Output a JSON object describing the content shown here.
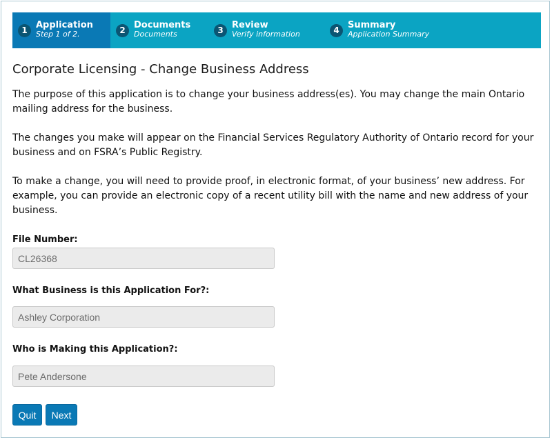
{
  "wizard": {
    "steps": [
      {
        "number": "1",
        "title": "Application",
        "subtitle": "Step 1 of 2."
      },
      {
        "number": "2",
        "title": "Documents",
        "subtitle": "Documents"
      },
      {
        "number": "3",
        "title": "Review",
        "subtitle": "Verify information"
      },
      {
        "number": "4",
        "title": "Summary",
        "subtitle": "Application Summary"
      }
    ],
    "active_step": 1
  },
  "page": {
    "title": "Corporate Licensing - Change Business Address",
    "paragraphs": [
      "The purpose of this application is to change your business address(es). You may change the main Ontario mailing address for the business.",
      "The changes you make will appear on the Financial Services Regulatory Authority of Ontario record for your business and on FSRA’s Public Registry.",
      "To make a change, you will need to provide proof, in electronic format, of your business’ new address. For example, you can provide an electronic copy of a recent utility bill with the name and new address of your business."
    ]
  },
  "form": {
    "file_number": {
      "label": "File Number:",
      "value": "CL26368"
    },
    "business": {
      "label": "What Business is this Application For?:",
      "value": "Ashley Corporation"
    },
    "applicant": {
      "label": "Who is Making this Application?:",
      "value": "Pete Andersone"
    }
  },
  "buttons": {
    "quit": "Quit",
    "next": "Next"
  },
  "colors": {
    "wizard_bg": "#0ba4c3",
    "active_step_bg": "#0a79b5",
    "step_number_bg": "#0b5573",
    "button_bg": "#0a79b5",
    "input_bg": "#ebebeb"
  }
}
